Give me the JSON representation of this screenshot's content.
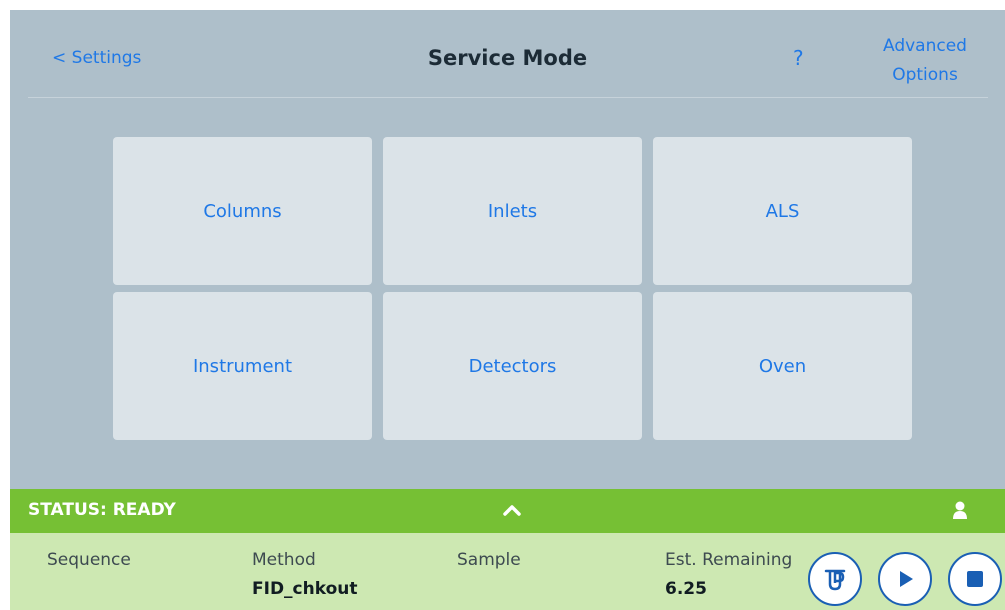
{
  "header": {
    "back_label": "< Settings",
    "title": "Service Mode",
    "help_label": "?",
    "advanced_line1": "Advanced",
    "advanced_line2": "Options"
  },
  "tiles": [
    {
      "label": "Columns"
    },
    {
      "label": "Inlets"
    },
    {
      "label": "ALS"
    },
    {
      "label": "Instrument"
    },
    {
      "label": "Detectors"
    },
    {
      "label": "Oven"
    }
  ],
  "status": {
    "text": "STATUS: READY",
    "color": "#76c034"
  },
  "info": {
    "sequence_label": "Sequence",
    "method_label": "Method",
    "method_value": "FID_chkout",
    "sample_label": "Sample",
    "remaining_label": "Est. Remaining",
    "remaining_value": "6.25"
  },
  "controls": {
    "icons": [
      "vial-tray-icon",
      "play-icon",
      "stop-icon"
    ]
  },
  "colors": {
    "accent": "#1f78e6",
    "background": "#aebfca",
    "tile": "#dbe3e8",
    "info_panel": "#cde8b2"
  }
}
